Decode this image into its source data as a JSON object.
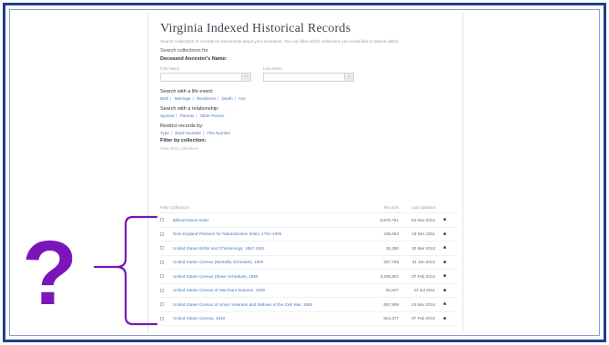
{
  "page": {
    "title": "Virginia Indexed Historical Records",
    "intro": "Search collections of records for documents about your ancestors. You can filter which collections you would like to search within.",
    "search_collections_for": "Search collections for",
    "deceased_label": "Deceased Ancestor's Name:",
    "first_name_label": "First Name",
    "last_name_label": "Last Name",
    "clear_glyph": "×",
    "life_event_label": "Search with a life event:",
    "life_events": [
      "Birth",
      "Marriage",
      "Residence",
      "Death",
      "Any"
    ],
    "relationship_label": "Search with a relationship:",
    "relationships": [
      "Spouse",
      "Parents",
      "Other Person"
    ],
    "restrict_label": "Restrict records by:",
    "restrict_options": [
      "Type",
      "Batch Number",
      "Film Number"
    ],
    "filter_label": "Filter by collection:",
    "view_all": "View all 51 collections"
  },
  "table": {
    "headers": [
      "Filter Collections",
      "Records",
      "Last Updated"
    ],
    "rows": [
      {
        "name": "BillionGraves Index",
        "records": "6,870,761",
        "updated": "04 Nov 2014"
      },
      {
        "name": "New England Petitions for Naturalization Index, 1791-1906",
        "records": "435,653",
        "updated": "19 Dec 2011"
      },
      {
        "name": "United States Births and Christenings, 1867-1931",
        "records": "35,350",
        "updated": "30 Mar 2012"
      },
      {
        "name": "United States Census (Mortality Schedule), 1850",
        "records": "257,789",
        "updated": "31 Jan 2014"
      },
      {
        "name": "United States Census (Slave Schedule), 1850",
        "records": "3,205,801",
        "updated": "07 Feb 2014"
      },
      {
        "name": "United States Census of Merchant Seamen, 1930",
        "records": "62,527",
        "updated": "12 Jul 2011"
      },
      {
        "name": "United States Census of Union Veterans and Widows of the Civil War, 1890",
        "records": "897,899",
        "updated": "24 Nov 2014"
      },
      {
        "name": "United States Census, 1810",
        "records": "824,377",
        "updated": "07 Feb 2012"
      }
    ],
    "camera_glyph": "■"
  },
  "annotation": {
    "question_mark": "?",
    "brace_color": "#7a16b8"
  }
}
